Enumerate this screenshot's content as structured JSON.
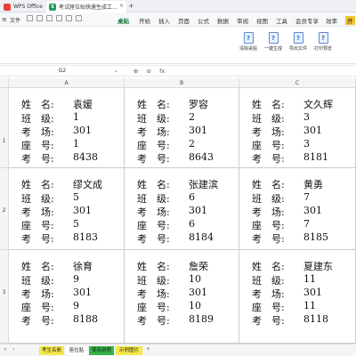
{
  "titlebar": {
    "app_name": "WPS Office",
    "doc_title": "考试座位贴快速生成工具V3.xl",
    "doc_logo": "S",
    "close_glyph": "×",
    "new_tab_glyph": "+"
  },
  "ribbon": {
    "menu_glyph": "≡",
    "file_label": "文件",
    "tabs": [
      "开始",
      "插入",
      "页面",
      "公式",
      "数据",
      "审阅",
      "视图",
      "工具",
      "会员专享",
      "效率",
      "开"
    ],
    "active_tab": "桌贴",
    "buttons": [
      "清除桌贴",
      "一键生成",
      "导出文件",
      "打印预览"
    ],
    "button_glyph": "?"
  },
  "formula": {
    "cell_ref": "G2",
    "arrow": "⌄",
    "icons": [
      "⊕",
      "⊘",
      "fx"
    ]
  },
  "columns": [
    "A",
    "B",
    "C"
  ],
  "rows": [
    "1",
    "2",
    "3"
  ],
  "field_labels": {
    "name": "姓　名:",
    "class": "班　级:",
    "room": "考　场:",
    "seat": "座　号:",
    "exam_no": "考　号:"
  },
  "cards": [
    {
      "name": "袁媛",
      "class": "1",
      "room": "301",
      "seat": "1",
      "exam_no": "8438"
    },
    {
      "name": "罗容",
      "class": "2",
      "room": "301",
      "seat": "2",
      "exam_no": "8643"
    },
    {
      "name": "文久辉",
      "class": "3",
      "room": "301",
      "seat": "3",
      "exam_no": "8181"
    },
    {
      "name": "缪文成",
      "class": "5",
      "room": "301",
      "seat": "5",
      "exam_no": "8183"
    },
    {
      "name": "张建滨",
      "class": "6",
      "room": "301",
      "seat": "6",
      "exam_no": "8184"
    },
    {
      "name": "黄勇",
      "class": "7",
      "room": "301",
      "seat": "7",
      "exam_no": "8185"
    },
    {
      "name": "徐育",
      "class": "9",
      "room": "301",
      "seat": "9",
      "exam_no": "8188"
    },
    {
      "name": "詹荣",
      "class": "10",
      "room": "301",
      "seat": "10",
      "exam_no": "8189"
    },
    {
      "name": "夏建东",
      "class": "11",
      "room": "301",
      "seat": "11",
      "exam_no": "8118"
    }
  ],
  "sheet_tabs": [
    {
      "label": "考生名册",
      "color": "#f5e84a"
    },
    {
      "label": "座位贴",
      "color": "#ffffff"
    },
    {
      "label": "使用说明",
      "color": "#37b44a"
    },
    {
      "label": "示例图片",
      "color": "#f5e84a"
    }
  ],
  "sheet_nav": [
    "«",
    "‹"
  ],
  "add_sheet": "+"
}
